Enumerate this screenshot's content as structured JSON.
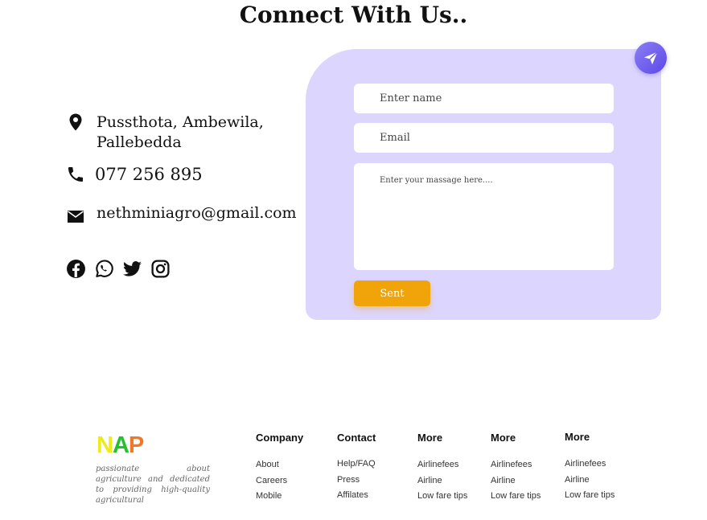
{
  "heading": "Connect With Us..",
  "contact": {
    "address": "Pussthota, Ambewila, Pallebedda",
    "phone": "077 256 895",
    "email": "nethminiagro@gmail.com"
  },
  "social_icons": [
    "facebook-icon",
    "whatsapp-icon",
    "twitter-icon",
    "instagram-icon"
  ],
  "form": {
    "name_placeholder": "Enter name",
    "email_placeholder": "Email",
    "message_placeholder": "Enter your massage here....",
    "submit_label": "Sent"
  },
  "colors": {
    "card": "#dcd6fe",
    "accent": "#6a5af0",
    "button": "#f0a40a"
  },
  "footer": {
    "logo": {
      "n": "N",
      "a": "A",
      "p": "P"
    },
    "tagline": "passionate about agriculture and dedicated to providing high-quality agricultural",
    "columns": [
      {
        "title": "Company",
        "links": [
          "About",
          "Careers",
          "Mobile"
        ]
      },
      {
        "title": "Contact",
        "links": [
          "Help/FAQ",
          "Press",
          "Affilates"
        ]
      },
      {
        "title": "More",
        "links": [
          "Airlinefees",
          "Airline",
          "Low fare tips"
        ]
      },
      {
        "title": "More",
        "links": [
          "Airlinefees",
          "Airline",
          "Low fare tips"
        ]
      },
      {
        "title": "More",
        "links": [
          "Airlinefees",
          "Airline",
          "Low fare tips"
        ]
      }
    ]
  }
}
